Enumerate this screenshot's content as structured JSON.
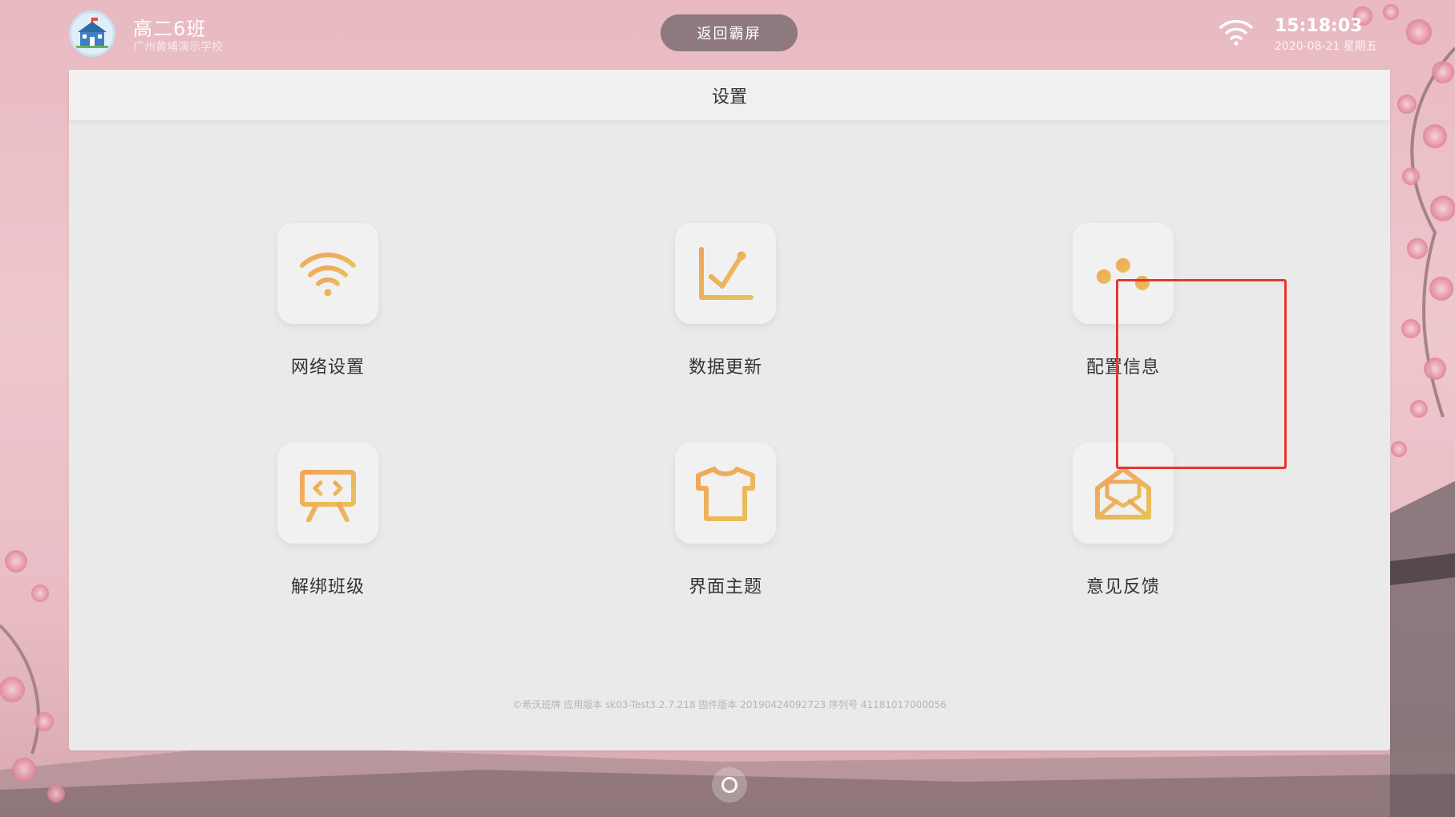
{
  "header": {
    "class_name": "高二6班",
    "school_name": "广州黄埔演示学校",
    "back_button_label": "返回霸屏",
    "time": "15:18:03",
    "date": "2020-08-21 星期五"
  },
  "settings": {
    "title": "设置",
    "tiles": [
      {
        "label": "网络设置",
        "icon": "wifi-icon"
      },
      {
        "label": "数据更新",
        "icon": "chart-icon"
      },
      {
        "label": "配置信息",
        "icon": "sliders-icon",
        "highlighted": true
      },
      {
        "label": "解绑班级",
        "icon": "presentation-board-icon"
      },
      {
        "label": "界面主题",
        "icon": "shirt-icon"
      },
      {
        "label": "意见反馈",
        "icon": "mail-icon"
      }
    ],
    "version": "©希沃班牌 应用版本 sk03-Test3.2.7.218 固件版本 20190424092723 序列号 41181017000056"
  },
  "colors": {
    "icon_gradient_start": "#f0a45c",
    "icon_gradient_end": "#e8c25a",
    "highlight": "#e8362d",
    "background": "#ecc3ca"
  }
}
